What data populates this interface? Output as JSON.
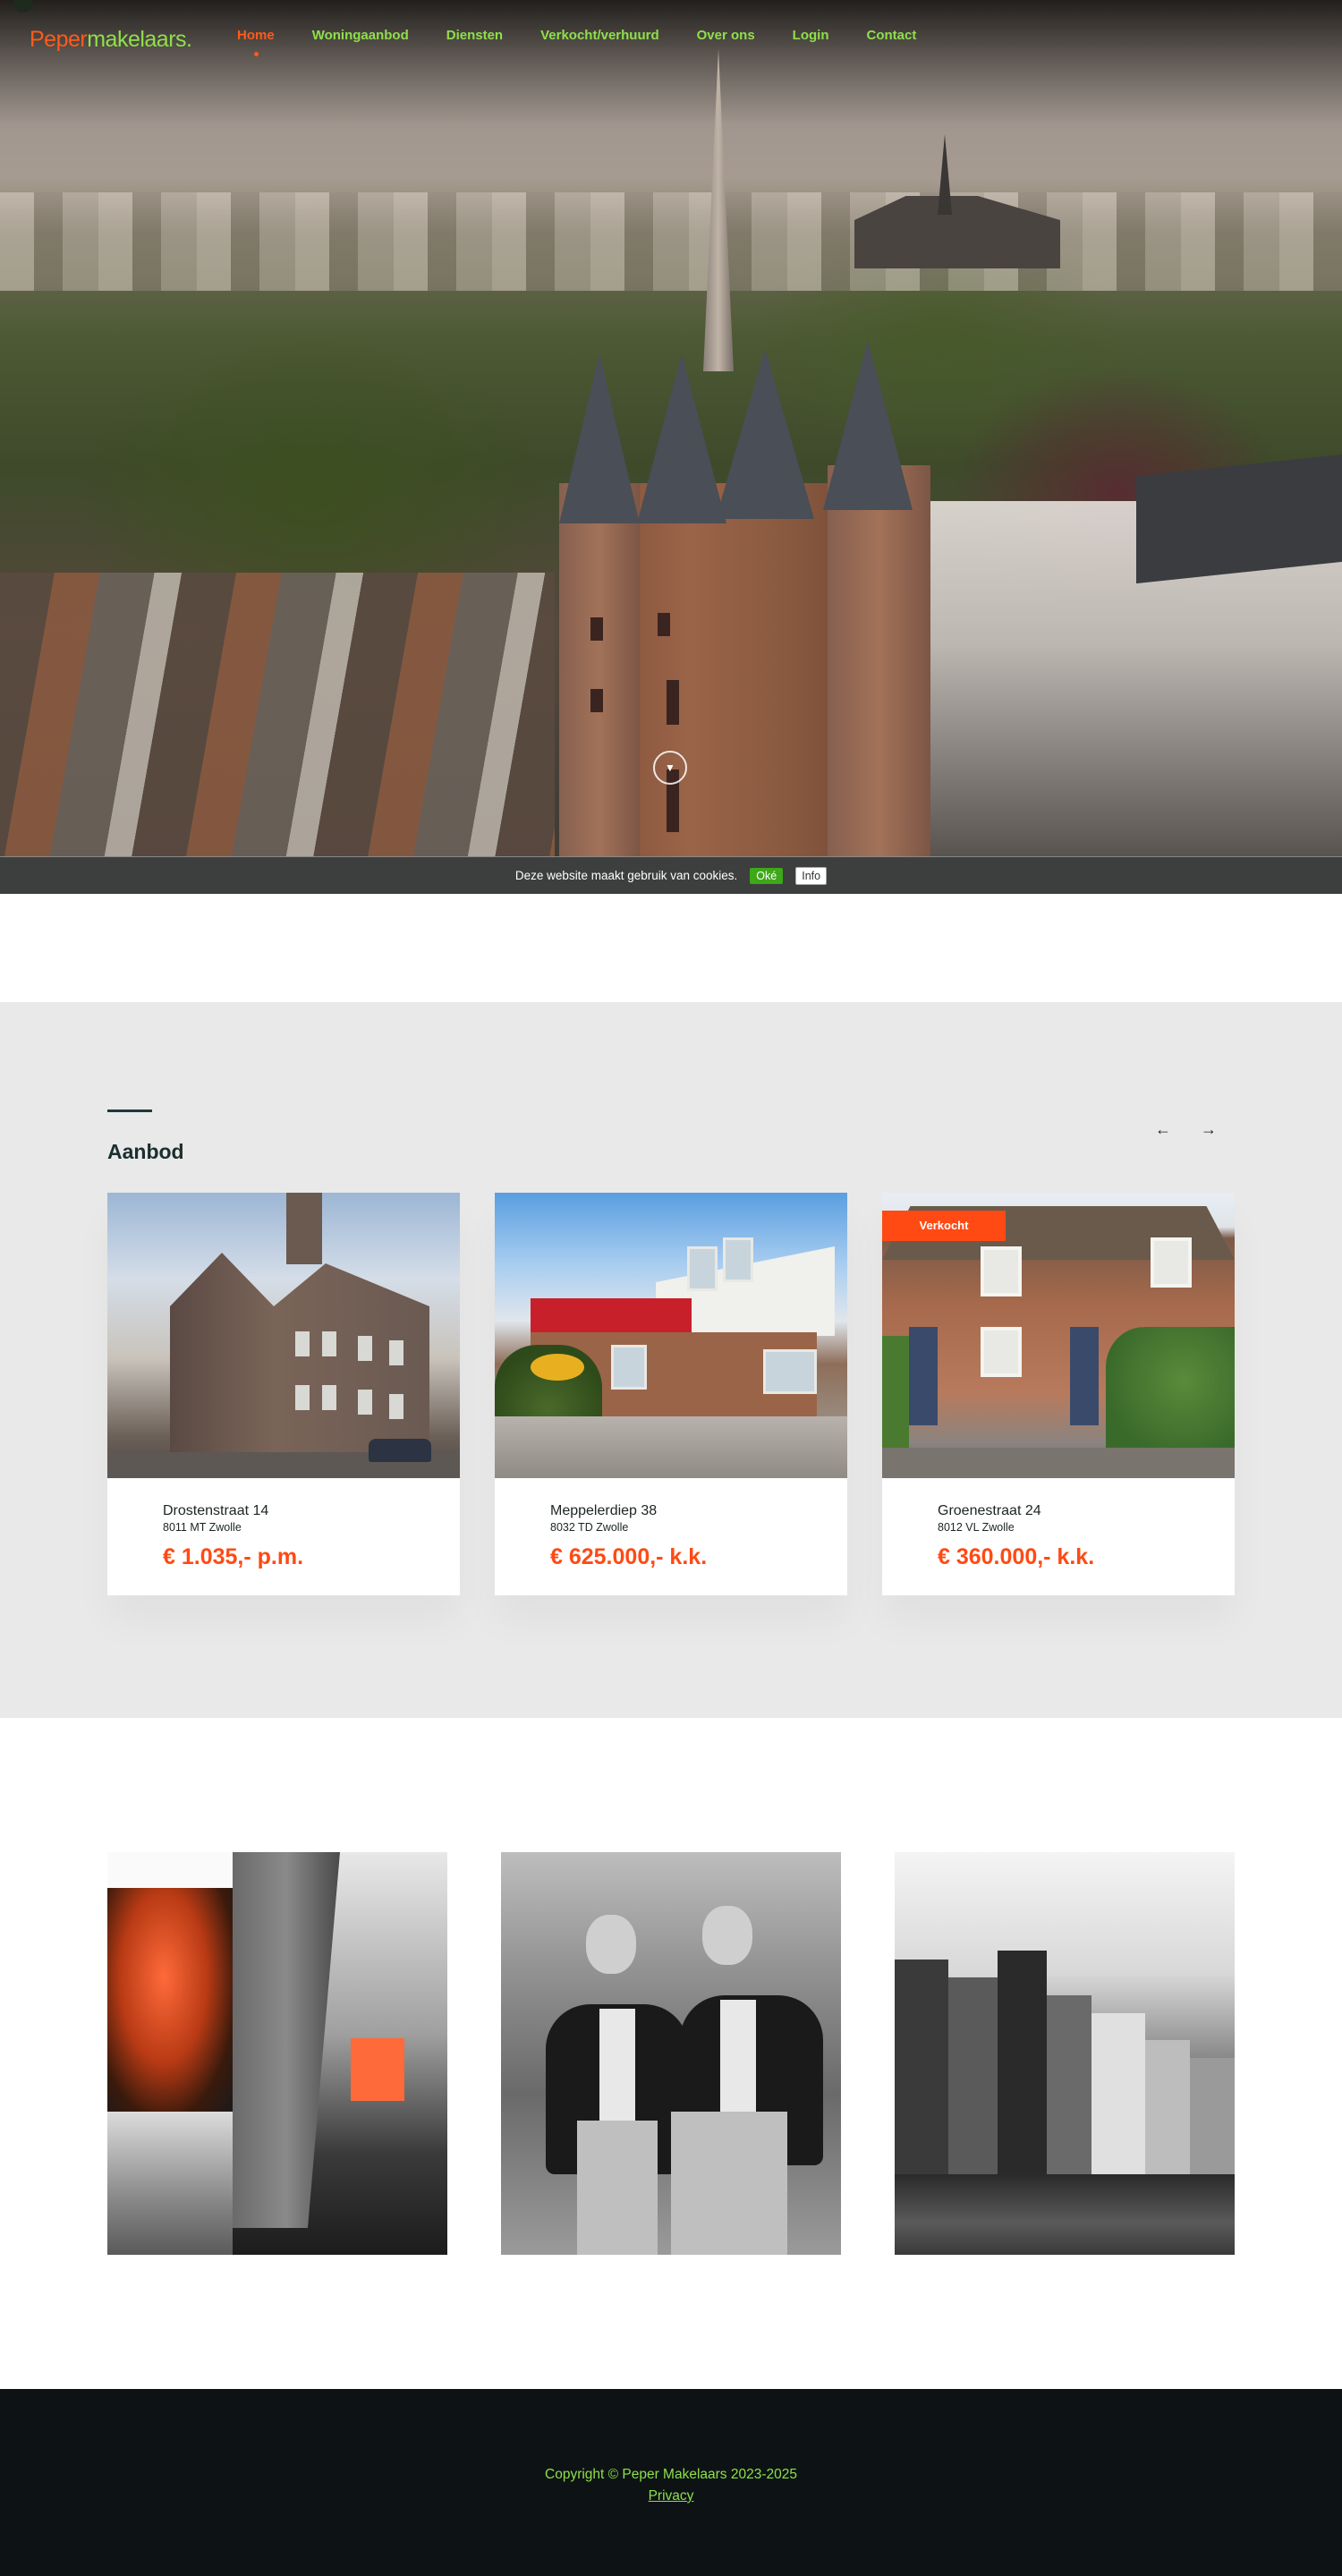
{
  "brand": {
    "logo_part1": "Peper",
    "logo_part2": "makelaars.",
    "color_orange": "#ff5a1a",
    "color_green": "#8ee04a"
  },
  "nav": {
    "items": [
      {
        "label": "Home",
        "active": true
      },
      {
        "label": "Woningaanbod"
      },
      {
        "label": "Diensten"
      },
      {
        "label": "Verkocht/verhuurd"
      },
      {
        "label": "Over ons"
      },
      {
        "label": "Login"
      },
      {
        "label": "Contact"
      }
    ]
  },
  "hero": {
    "scroll_icon": "chevron-down-icon"
  },
  "cookie": {
    "message": "Deze website maakt gebruik van cookies.",
    "ok_label": "Oké",
    "info_label": "Info"
  },
  "aanbod": {
    "title": "Aanbod",
    "prev_icon": "arrow-left-icon",
    "next_icon": "arrow-right-icon",
    "prev_glyph": "←",
    "next_glyph": "→",
    "listings": [
      {
        "street": "Drostenstraat 14",
        "postal": "8011 MT Zwolle",
        "price": "€ 1.035,- p.m.",
        "badge": ""
      },
      {
        "street": "Meppelerdiep 38",
        "postal": "8032 TD Zwolle",
        "price": "€ 625.000,- k.k.",
        "badge": ""
      },
      {
        "street": "Groenestraat 24",
        "postal": "8012 VL Zwolle",
        "price": "€ 360.000,- k.k.",
        "badge": "Verkocht"
      }
    ]
  },
  "footer": {
    "copyright": "Copyright © Peper Makelaars 2023-2025",
    "privacy_label": "Privacy"
  }
}
